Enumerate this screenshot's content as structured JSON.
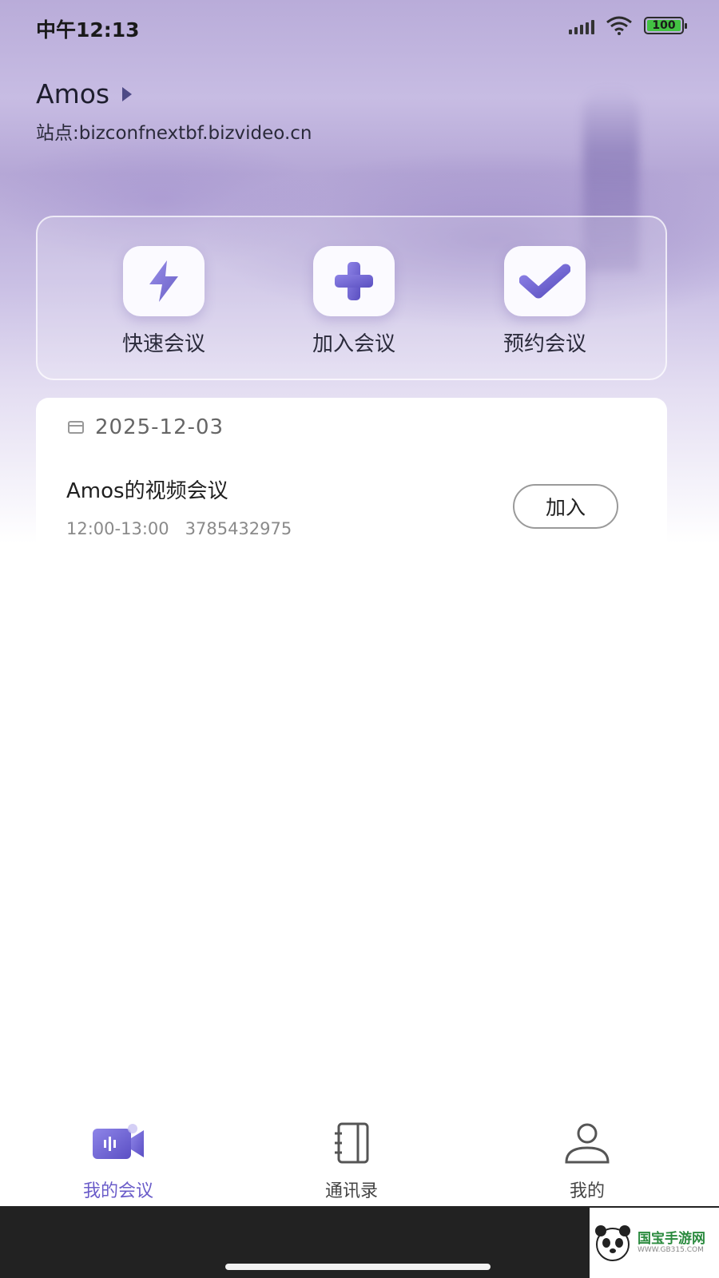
{
  "status_bar": {
    "time": "中午12:13",
    "battery": "100"
  },
  "user": {
    "name": "Amos",
    "site": "站点:bizconfnextbf.bizvideo.cn"
  },
  "quick_actions": [
    {
      "label": "快速会议",
      "icon": "lightning-icon"
    },
    {
      "label": "加入会议",
      "icon": "plus-icon"
    },
    {
      "label": "预约会议",
      "icon": "check-icon"
    }
  ],
  "meetings": {
    "date": "2025-12-03",
    "items": [
      {
        "title": "Amos的视频会议",
        "time": "12:00-13:00",
        "id": "3785432975",
        "action": "加入"
      }
    ]
  },
  "tabs": [
    {
      "label": "我的会议",
      "icon": "video-camera-icon",
      "active": true
    },
    {
      "label": "通讯录",
      "icon": "contacts-book-icon",
      "active": false
    },
    {
      "label": "我的",
      "icon": "person-icon",
      "active": false
    }
  ],
  "watermark": {
    "brand": "国宝手游网",
    "url": "WWW.GB315.COM"
  },
  "colors": {
    "accent": "#6a5cc9",
    "battery": "#43c243"
  }
}
